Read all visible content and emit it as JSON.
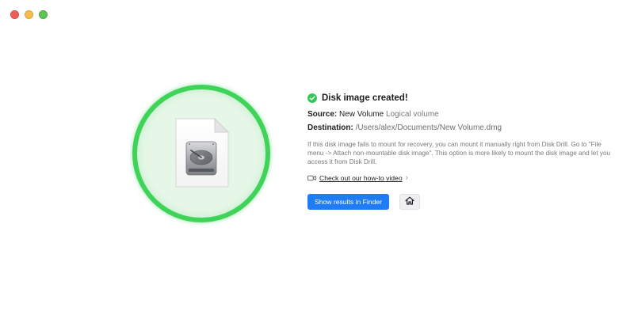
{
  "window": {
    "controls": [
      "close",
      "minimize",
      "maximize"
    ]
  },
  "illustration": {
    "icon": "disk-image-file-icon",
    "ring_color": "#3fd35a"
  },
  "status": {
    "icon": "checkmark-circle-icon",
    "title": "Disk image created!"
  },
  "details": {
    "source_label": "Source:",
    "source_name": "New Volume",
    "source_type": "Logical volume",
    "destination_label": "Destination:",
    "destination_path": "/Users/alex/Documents/New Volume.dmg"
  },
  "description": "If this disk image fails to mount for recovery, you can mount it manually right from Disk Drill. Go to \"File menu -> Attach non-mountable disk image\". This option is more likely to mount the disk image and let you access it from Disk Drill.",
  "howto": {
    "icon": "video-camera-icon",
    "label": "Check out our how-to video",
    "chevron": "›"
  },
  "actions": {
    "primary_label": "Show results in Finder",
    "home_icon": "home-icon"
  },
  "colors": {
    "accent": "#1f7cf5",
    "success": "#34c759"
  }
}
